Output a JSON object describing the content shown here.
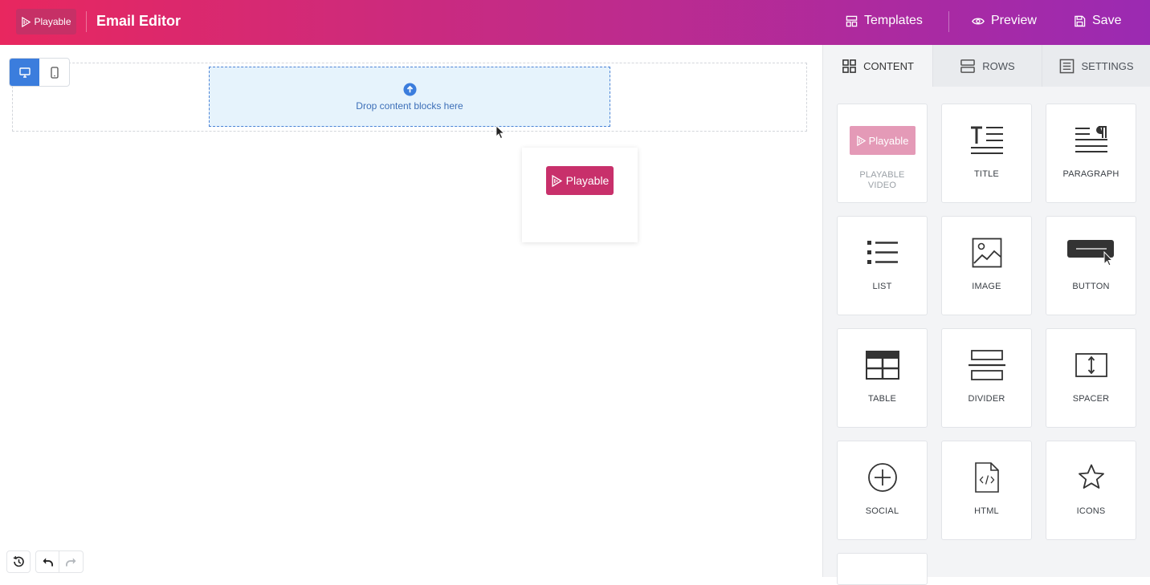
{
  "header": {
    "logo_text": "Playable",
    "title": "Email Editor",
    "templates_label": "Templates",
    "preview_label": "Preview",
    "save_label": "Save"
  },
  "canvas": {
    "dropzone_text": "Drop content blocks here",
    "drag_preview_logo": "Playable",
    "device_mode": "desktop"
  },
  "sidebar": {
    "tabs": [
      {
        "label": "CONTENT",
        "icon": "grid-icon"
      },
      {
        "label": "ROWS",
        "icon": "rows-icon"
      },
      {
        "label": "SETTINGS",
        "icon": "settings-icon"
      }
    ],
    "blocks": [
      {
        "label": "PLAYABLE VIDEO",
        "logo": "Playable"
      },
      {
        "label": "TITLE"
      },
      {
        "label": "PARAGRAPH"
      },
      {
        "label": "LIST"
      },
      {
        "label": "IMAGE"
      },
      {
        "label": "BUTTON"
      },
      {
        "label": "TABLE"
      },
      {
        "label": "DIVIDER"
      },
      {
        "label": "SPACER"
      },
      {
        "label": "SOCIAL"
      },
      {
        "label": "HTML"
      },
      {
        "label": "ICONS"
      }
    ]
  },
  "colors": {
    "header_gradient_start": "#e8275f",
    "header_gradient_end": "#9b2ab2",
    "accent_blue": "#3b7ddd",
    "playable_pink": "#c8306b"
  }
}
